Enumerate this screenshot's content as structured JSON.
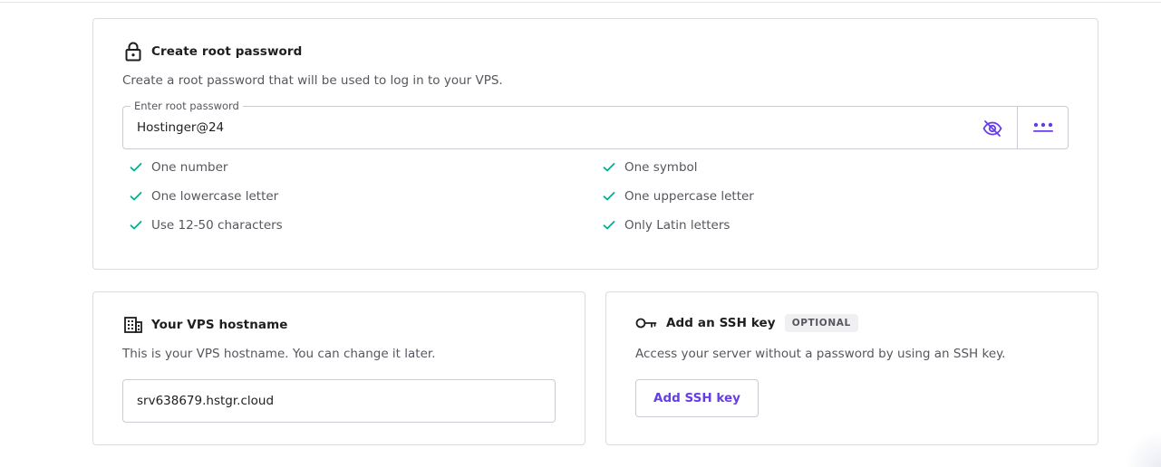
{
  "root_password": {
    "title": "Create root password",
    "description": "Create a root password that will be used to log in to your VPS.",
    "field_label": "Enter root password",
    "field_value": "Hostinger@24",
    "requirements_left": [
      {
        "label": "One number",
        "met": true
      },
      {
        "label": "One lowercase letter",
        "met": true
      },
      {
        "label": "Use 12-50 characters",
        "met": true
      }
    ],
    "requirements_right": [
      {
        "label": "One symbol",
        "met": true
      },
      {
        "label": "One uppercase letter",
        "met": true
      },
      {
        "label": "Only Latin letters",
        "met": true
      }
    ]
  },
  "hostname": {
    "title": "Your VPS hostname",
    "description": "This is your VPS hostname. You can change it later.",
    "value": "srv638679.hstgr.cloud"
  },
  "ssh_key": {
    "title": "Add an SSH key",
    "badge": "OPTIONAL",
    "description": "Access your server without a password by using an SSH key.",
    "button_label": "Add SSH key"
  },
  "icons": {
    "lock": "lock-icon",
    "eye_off": "eye-off-icon",
    "generate": "dots-icon",
    "check": "check-icon",
    "building": "building-icon",
    "key": "key-icon"
  },
  "colors": {
    "accent": "#673de6",
    "check": "#00b090",
    "text": "#1d1e20",
    "muted": "#55575d",
    "border": "#dadce0"
  }
}
